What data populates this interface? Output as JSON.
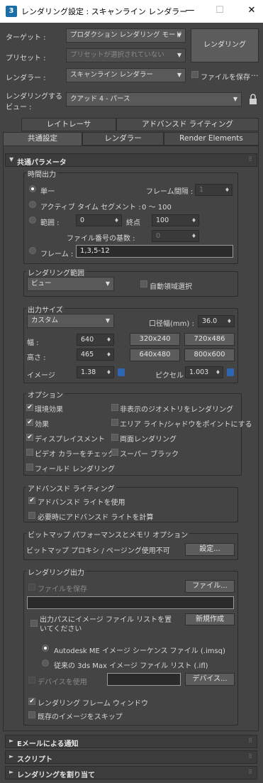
{
  "window": {
    "title": "レンダリング設定 : スキャンライン レンダラー",
    "icon": "3",
    "minimize": "—",
    "maximize": "☐",
    "close": "✕"
  },
  "header": {
    "target_label": "ターゲット :",
    "target_value": "プロダクション レンダリング モード",
    "preset_label": "プリセット :",
    "preset_value": "プリセットが選択されていない",
    "renderer_label": "レンダラー :",
    "renderer_value": "スキャンライン レンダラー",
    "save_file_label": "ファイルを保存",
    "more": "...",
    "view_label_1": "レンダリングする",
    "view_label_2": "ビュー :",
    "view_value": "クアッド 4 - パース",
    "render_button": "レンダリング"
  },
  "tabs": {
    "row1": [
      "レイトレーサ",
      "アドバンスド ライティング"
    ],
    "row2": [
      "共通設定",
      "レンダラー",
      "Render Elements"
    ]
  },
  "common": {
    "title": "共通パラメータ",
    "time_output": {
      "label": "時間出力",
      "single": "単一",
      "frame_every": "フレーム間隔 :",
      "frame_every_value": "1",
      "active_segment": "アクティブ タイム セグメント :",
      "active_segment_value": "0 ～ 100",
      "range": "範囲 :",
      "range_from": "0",
      "range_to_label": "終点",
      "range_to": "100",
      "file_number_base": "ファイル番号の基数 :",
      "file_number_base_value": "0",
      "frames": "フレーム :",
      "frames_value": "1,3,5-12"
    },
    "render_area": {
      "label": "レンダリング範囲",
      "value": "ビュー",
      "auto_region": "自動領域選択"
    },
    "output_size": {
      "label": "出力サイズ",
      "preset": "カスタム",
      "aperture_label": "口径幅(mm) :",
      "aperture_value": "36.0",
      "width_label": "幅 :",
      "width_value": "640",
      "height_label": "高さ :",
      "height_value": "465",
      "sizes": [
        "320x240",
        "720x486",
        "640x480",
        "800x600"
      ],
      "image_aspect_label": "イメージ",
      "image_aspect_value": "1.38",
      "pixel_aspect_label": "ピクセル",
      "pixel_aspect_value": "1.003"
    },
    "options": {
      "label": "オプション",
      "items": [
        {
          "label": "環境効果",
          "checked": "✔"
        },
        {
          "label": "非表示のジオメトリをレンダリング",
          "checked": ""
        },
        {
          "label": "効果",
          "checked": "✔"
        },
        {
          "label": "エリア ライト/シャドウをポイントにする",
          "checked": ""
        },
        {
          "label": "ディスプレイスメント",
          "checked": "✔"
        },
        {
          "label": "両面レンダリング",
          "checked": ""
        },
        {
          "label": "ビデオ カラーをチェック",
          "checked": ""
        },
        {
          "label": "スーパー ブラック",
          "checked": ""
        },
        {
          "label": "フィールド レンダリング",
          "checked": ""
        }
      ]
    },
    "adv_lighting": {
      "label": "アドバンスド ライティング",
      "use": "アドバンスド ライトを使用",
      "use_checked": "✔",
      "compute": "必要時にアドバンスド ライトを計算",
      "compute_checked": ""
    },
    "bitmap": {
      "label": "ビットマップ パフォーマンスとメモリ オプション",
      "text": "ビットマップ プロキシ / ページング使用不可",
      "button": "設定..."
    },
    "render_output": {
      "label": "レンダリング出力",
      "save_file": "ファイルを保存",
      "files_button": "ファイル...",
      "path_value": "",
      "put_list": "出力パスにイメージ ファイル リストを置いてください",
      "create_button": "新規作成",
      "imsq": "Autodesk ME イメージ シーケンス ファイル (.imsq)",
      "ifl": "従来の 3ds Max イメージ ファイル リスト (.ifl)",
      "use_device": "デバイスを使用",
      "device_value": "",
      "devices_button": "デバイス...",
      "frame_window": "レンダリング フレーム ウィンドウ",
      "frame_window_checked": "✔",
      "skip": "既存のイメージをスキップ",
      "skip_checked": ""
    }
  },
  "rollouts": [
    "Eメールによる通知",
    "スクリプト",
    "レンダリングを割り当て"
  ],
  "glyphs": {
    "expand": "▼",
    "collapsed": "►",
    "grip": "⠿",
    "dd_arrow": "▼",
    "spin": "♦"
  }
}
